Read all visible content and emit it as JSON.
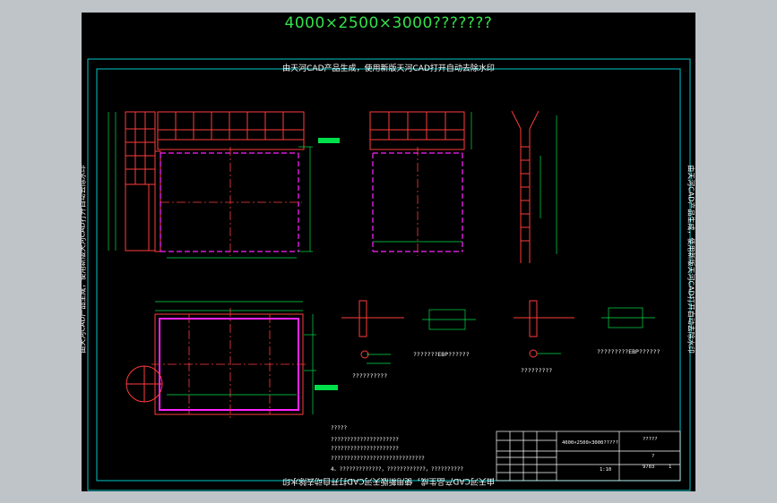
{
  "drawing": {
    "title": "4000×2500×3000???????",
    "watermark_banner": "由天河CAD产品生成，使用新版天河CAD打开自动去除水印",
    "detail_labels": [
      "??????????",
      "???????EBP??????",
      "?????????",
      "?????????EBP??????"
    ],
    "notes_heading": "?????",
    "notes_lines": [
      "?????????????????????",
      "?????????????????????",
      "?????????????????????????????",
      "4、?????????????，????????????，??????????"
    ],
    "title_block": {
      "drawing_name": "4000×2500×3000?????",
      "company": "?????",
      "cells": [
        "?",
        "1:10",
        "9703",
        "1"
      ]
    }
  },
  "colors": {
    "background": "#000000",
    "frame": "#00c8c8",
    "steel_outline": "#ff3b3b",
    "dim_green": "#00e04a",
    "centerline": "#ff3b3b",
    "hidden_magenta": "#ff22ff",
    "text_white": "#ffffff",
    "title_green": "#35e04a"
  }
}
